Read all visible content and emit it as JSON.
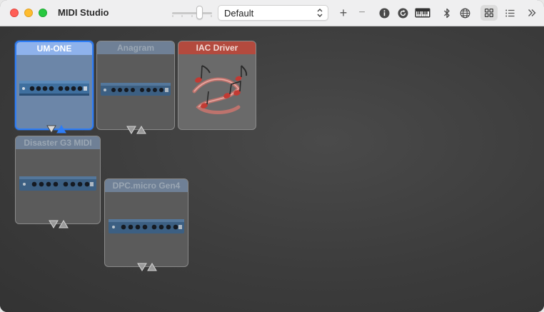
{
  "window": {
    "title": "MIDI Studio"
  },
  "toolbar": {
    "configuration_value": "Default",
    "add_label": "+",
    "remove_label": "−",
    "icons": [
      "info-icon",
      "rescan-icon",
      "test-setup-keyboard-icon",
      "bluetooth-icon",
      "network-icon",
      "icon-view-icon",
      "list-view-icon",
      "more-icon"
    ],
    "selected_view": "icon-view"
  },
  "devices": [
    {
      "name": "UM-ONE",
      "state": "selected"
    },
    {
      "name": "Anagram",
      "state": "offline"
    },
    {
      "name": "IAC Driver",
      "state": "online"
    },
    {
      "name": "Disaster G3 MIDI",
      "state": "offline"
    },
    {
      "name": "DPC.micro Gen4",
      "state": "offline"
    }
  ],
  "colors": {
    "selection": "#2e7df6",
    "iac_header": "#b34a3e",
    "offline_header": "#6f8096",
    "online_header": "#8eb2ec"
  }
}
